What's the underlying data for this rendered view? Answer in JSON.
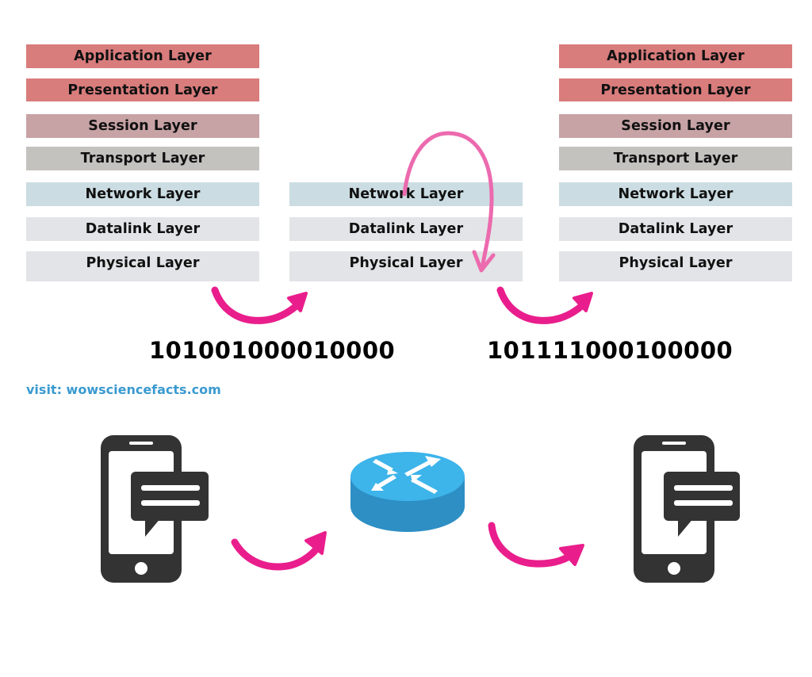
{
  "colors": {
    "application": "#d97c7c",
    "presentation": "#d97c7c",
    "session": "#c7a3a6",
    "transport": "#c4c2bf",
    "network": "#cbdde2",
    "datalink": "#e2e4e7",
    "physical": "#e2e4e7",
    "arrow": "#e91e8c",
    "loop_arrow": "#ec6aae",
    "phone": "#333333",
    "router_top": "#3db4ea",
    "router_side": "#2d8fc4",
    "link": "#3a9ad0"
  },
  "sender_stack": {
    "layers": [
      {
        "key": "application",
        "label": "Application Layer"
      },
      {
        "key": "presentation",
        "label": "Presentation Layer"
      },
      {
        "key": "session",
        "label": "Session Layer"
      },
      {
        "key": "transport",
        "label": "Transport Layer"
      },
      {
        "key": "network",
        "label": "Network Layer"
      },
      {
        "key": "datalink",
        "label": "Datalink Layer"
      },
      {
        "key": "physical",
        "label": "Physical Layer"
      }
    ]
  },
  "router_stack": {
    "layers": [
      {
        "key": "network",
        "label": "Network Layer"
      },
      {
        "key": "datalink",
        "label": "Datalink Layer"
      },
      {
        "key": "physical",
        "label": "Physical Layer"
      }
    ]
  },
  "receiver_stack": {
    "layers": [
      {
        "key": "application",
        "label": "Application Layer"
      },
      {
        "key": "presentation",
        "label": "Presentation Layer"
      },
      {
        "key": "session",
        "label": "Session Layer"
      },
      {
        "key": "transport",
        "label": "Transport Layer"
      },
      {
        "key": "network",
        "label": "Network Layer"
      },
      {
        "key": "datalink",
        "label": "Datalink Layer"
      },
      {
        "key": "physical",
        "label": "Physical Layer"
      }
    ]
  },
  "bitstreams": {
    "first": "101001000010000",
    "second": "101111000100000"
  },
  "footer": {
    "visit_text": "visit: wowsciencefacts.com"
  },
  "icons": {
    "sender": "smartphone-message-icon",
    "router": "router-icon",
    "receiver": "smartphone-message-icon",
    "arrows": "curved-arrow-icon"
  }
}
